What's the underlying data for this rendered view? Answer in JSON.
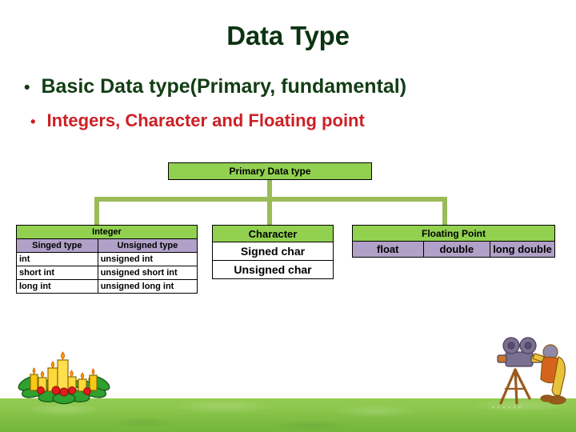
{
  "slide": {
    "title": "Data Type",
    "title_color": "#0c3311",
    "background_color": "#ffffff"
  },
  "bullets": [
    {
      "marker": "•",
      "text": "Basic Data type(Primary, fundamental)",
      "color": "#123d14"
    },
    {
      "marker": "•",
      "text": "Integers, Character and Floating point",
      "color": "#cc2026"
    }
  ],
  "diagram": {
    "root": {
      "label": "Primary Data type",
      "fill": "#92d050",
      "border": "#000000"
    },
    "connector_color": "#9bbb59",
    "header_fill": "#92d050",
    "subheader_fill": "#b1a0c7",
    "cell_fill": "#ffffff",
    "branches": [
      {
        "title": "Integer",
        "columns": [
          "Singed type",
          "Unsigned type"
        ],
        "rows": [
          [
            "int",
            "unsigned int"
          ],
          [
            "short int",
            "unsigned short int"
          ],
          [
            "long int",
            "unsigned long int"
          ]
        ]
      },
      {
        "title": "Character",
        "rows": [
          [
            "Signed char"
          ],
          [
            "Unsigned char"
          ]
        ]
      },
      {
        "title": "Floating Point",
        "columns": [
          "float",
          "double",
          "long double"
        ]
      }
    ]
  },
  "decorations": {
    "grass_watermark": "······",
    "candles_alt": "candles-clipart",
    "cameraman_alt": "cameraman-with-movie-camera-clipart"
  }
}
